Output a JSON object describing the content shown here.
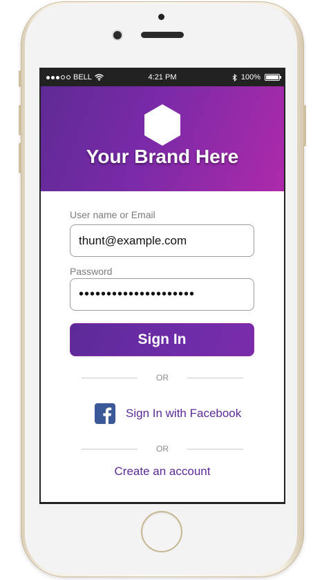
{
  "status_bar": {
    "carrier": "BELL",
    "time": "4:21 PM",
    "battery": "100%"
  },
  "brand": {
    "name": "Your Brand Here"
  },
  "login_form": {
    "username_label": "User name or Email",
    "username_value": "thunt@example.com",
    "password_label": "Password",
    "password_value": "•••••••••••••••••••••",
    "sign_in_label": "Sign In",
    "or_text_1": "OR",
    "facebook_label": "Sign In with Facebook",
    "or_text_2": "OR",
    "create_account_label": "Create an account"
  },
  "colors": {
    "accent": "#5b2a97",
    "brand_gradient_start": "#5f2a96",
    "brand_gradient_end": "#ad2aaa",
    "facebook_blue": "#3b5998"
  },
  "icons": {
    "brand_logo": "hexagon-icon",
    "facebook": "facebook-icon",
    "wifi": "wifi-icon",
    "bluetooth": "bluetooth-icon",
    "battery": "battery-icon"
  }
}
